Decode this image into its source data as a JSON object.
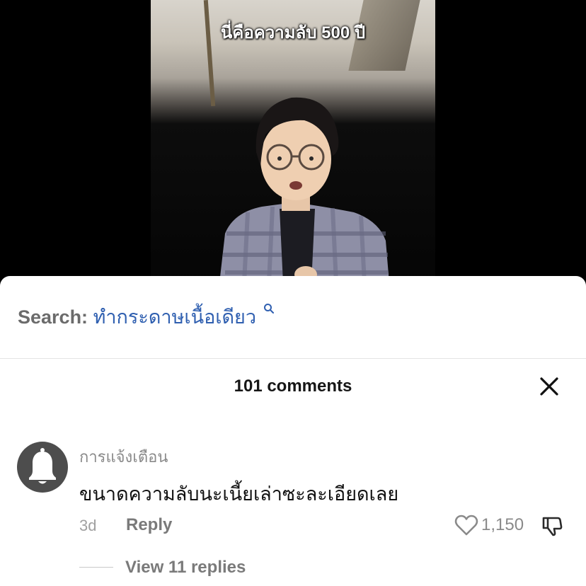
{
  "video": {
    "caption": "นี่คือความลับ 500 ปี"
  },
  "search": {
    "label": "Search:",
    "query": "ทำกระดาษเนื้อเดียว",
    "icon": "search-icon"
  },
  "comments_header": {
    "title": "101 comments",
    "close_icon": "close-icon"
  },
  "comment": {
    "avatar_icon": "bell-icon",
    "username": "การแจ้งเตือน",
    "text": "ขนาดความลับนะเนี้ยเล่าซะละเอียดเลย",
    "time": "3d",
    "reply_label": "Reply",
    "like_count": "1,150",
    "like_icon": "heart-icon",
    "dislike_icon": "thumbs-down-icon",
    "view_replies_label": "View 11 replies"
  },
  "colors": {
    "search_query": "#2f5fb0",
    "avatar_bg": "#4d4d4d",
    "sheet_bg": "#ffffff"
  }
}
